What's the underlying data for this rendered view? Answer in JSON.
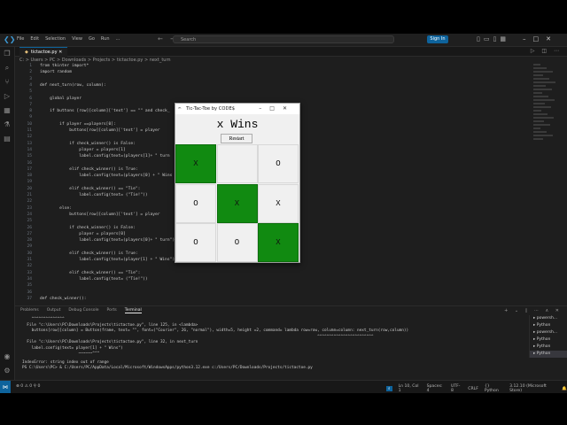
{
  "vscode": {
    "menu": [
      "File",
      "Edit",
      "Selection",
      "View",
      "Go",
      "Run",
      "..."
    ],
    "search_placeholder": "Search",
    "sign_in": "Sign In",
    "tab_label": "tictactoe.py",
    "breadcrumb": "C: > Users > PC > Downloads > Projects > tictactoe.py > next_turn"
  },
  "code_lines": [
    {
      "n": "1",
      "t": "from tkinter import*"
    },
    {
      "n": "2",
      "t": "import random"
    },
    {
      "n": "3",
      "t": ""
    },
    {
      "n": "4",
      "t": "def next_turn(row, column):"
    },
    {
      "n": "5",
      "t": ""
    },
    {
      "n": "6",
      "t": "    global player"
    },
    {
      "n": "7",
      "t": ""
    },
    {
      "n": "8",
      "t": "    if buttons [row][column]['text'] == \"\" and check_"
    },
    {
      "n": "9",
      "t": ""
    },
    {
      "n": "10",
      "t": "        if player ==players[0]:"
    },
    {
      "n": "11",
      "t": "            buttons[row][column]['text'] = player"
    },
    {
      "n": "12",
      "t": ""
    },
    {
      "n": "13",
      "t": "            if check_winner() is False:"
    },
    {
      "n": "14",
      "t": "                player = players[1]"
    },
    {
      "n": "15",
      "t": "                label.config(text=(players[1]+ \" turn"
    },
    {
      "n": "16",
      "t": ""
    },
    {
      "n": "17",
      "t": "            elif check_winner() is True:"
    },
    {
      "n": "18",
      "t": "                label.config(text=(players[0] + \" Wins"
    },
    {
      "n": "19",
      "t": ""
    },
    {
      "n": "20",
      "t": "            elif check_winner() == \"Tie\":"
    },
    {
      "n": "21",
      "t": "                label.config(text= (\"Tie!\"))"
    },
    {
      "n": "22",
      "t": ""
    },
    {
      "n": "23",
      "t": "        else:"
    },
    {
      "n": "24",
      "t": "            buttons[row][column]['text'] = player"
    },
    {
      "n": "25",
      "t": ""
    },
    {
      "n": "26",
      "t": "            if check_winner() is False:"
    },
    {
      "n": "27",
      "t": "                player = players[0]"
    },
    {
      "n": "28",
      "t": "                label.config(text=(players[0]+ \" turn\")"
    },
    {
      "n": "29",
      "t": ""
    },
    {
      "n": "30",
      "t": "            elif check_winner() is True:"
    },
    {
      "n": "31",
      "t": "                label.config(text=(player[1] + \" Wins\")"
    },
    {
      "n": "32",
      "t": ""
    },
    {
      "n": "33",
      "t": "            elif check_winner() == \"Tie\":"
    },
    {
      "n": "34",
      "t": "                label.config(text= (\"Tie!\"))"
    },
    {
      "n": "35",
      "t": ""
    },
    {
      "n": "36",
      "t": ""
    },
    {
      "n": "37",
      "t": "def check_winner():"
    }
  ],
  "panel": {
    "tabs": [
      "Problems",
      "Output",
      "Debug Console",
      "Ports",
      "Terminal"
    ],
    "active_tab": "Terminal",
    "terminal_lines": [
      "    ^^^^^^^^^^^^^^",
      "  File \"c:\\Users\\PC\\Downloads\\Projects\\tictactoe.py\", line 125, in <lambda>",
      "    buttons[row][column] = Button(frame, text= \"\", font=(\"Courier\", 26, \"normal\"), width=5, height =2, command= lambda row=row, column=column: next_turn(row,column))",
      "                                                                                                                              ^^^^^^^^^^^^^^^^^^^^^^^^",
      "  File \"c:\\Users\\PC\\Downloads\\Projects\\tictactoe.py\", line 32, in next_turn",
      "    label.config(text= player[1] + \" Wins\")",
      "                        ~~~~~~^^^",
      "IndexError: string index out of range",
      "PS C:\\Users\\PC> & C:/Users/PC/AppData/Local/Microsoft/WindowsApps/python3.12.exe c:/Users/PC/Downloads/Projects/tictactoe.py"
    ],
    "terminal_list": [
      "powersh...",
      "Python",
      "powersh...",
      "Python",
      "Python",
      "Python"
    ]
  },
  "status": {
    "left": "⊗ 0 ⚠ 0    ⚲ 0",
    "position": "Ln 10, Col 1",
    "spaces": "Spaces: 4",
    "encoding": "UTF-8",
    "eol": "CRLF",
    "language": "{} Python",
    "interpreter": "3.12.10 (Microsoft Store)"
  },
  "tk": {
    "title": "Tic-Tac-Toe by CODE$",
    "label": "x Wins",
    "restart": "Restart",
    "board": [
      [
        "X",
        "",
        "O"
      ],
      [
        "O",
        "X",
        "X"
      ],
      [
        "O",
        "O",
        "X"
      ]
    ],
    "win_cells": [
      [
        0,
        0
      ],
      [
        1,
        1
      ],
      [
        2,
        2
      ]
    ],
    "win_color": "#118a11"
  }
}
